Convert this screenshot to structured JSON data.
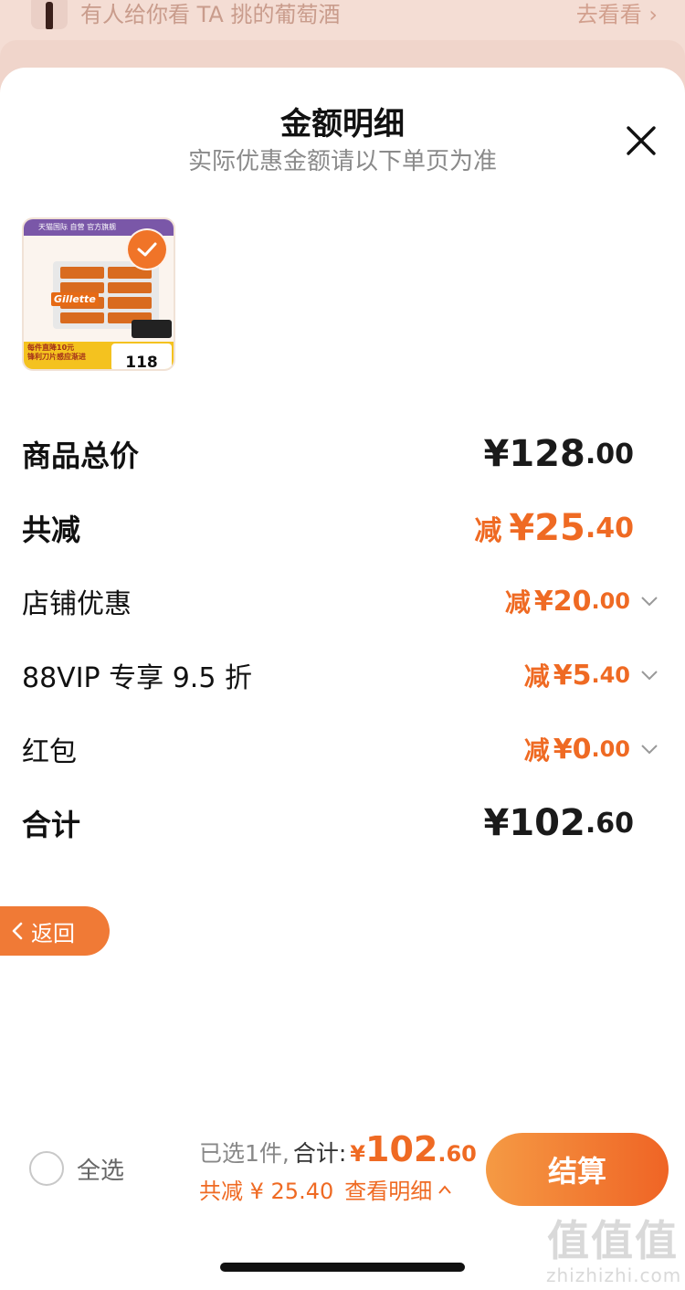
{
  "background": {
    "banner_text": "有人给你看 TA 挑的葡萄酒",
    "banner_link": "去看看 ›"
  },
  "sheet": {
    "title": "金额明细",
    "subtitle": "实际优惠金额请以下单页为准"
  },
  "product": {
    "thumb_topbar": "天猫国际 自营 官方旗舰",
    "brand": "Gillette",
    "promo_line1": "每件直降10元",
    "promo_line2": "锋利刀片感应渐进",
    "price": "118"
  },
  "rows": {
    "total_price": {
      "label": "商品总价",
      "yen": "¥",
      "int": "128",
      "dec": ".00"
    },
    "total_discount": {
      "label": "共减",
      "prefix": "减",
      "yen": "¥",
      "int": "25",
      "dec": ".40"
    },
    "shop_discount": {
      "label": "店铺优惠",
      "prefix": "减",
      "yen": "¥",
      "int": "20",
      "dec": ".00"
    },
    "vip_discount": {
      "label": "88VIP 专享 9.5 折",
      "prefix": "减",
      "yen": "¥",
      "int": "5",
      "dec": ".40"
    },
    "red_packet": {
      "label": "红包",
      "prefix": "减",
      "yen": "¥",
      "int": "0",
      "dec": ".00"
    },
    "grand_total": {
      "label": "合计",
      "yen": "¥",
      "int": "102",
      "dec": ".60"
    }
  },
  "return_button": {
    "label": "返回"
  },
  "bottom_bar": {
    "select_all": "全选",
    "selected_count": "已选1件,",
    "total_label": "合计:",
    "yen": "¥",
    "total_int": "102",
    "total_dec": ".60",
    "discount_text": "共减 ¥ 25.40",
    "detail_link": "查看明细",
    "checkout": "结算"
  },
  "watermark": {
    "big": "值值值",
    "small": "zhizhizhi.com"
  },
  "colors": {
    "accent": "#ef6a23",
    "checkout_gradient_start": "#f59a44",
    "checkout_gradient_end": "#ef6425"
  }
}
